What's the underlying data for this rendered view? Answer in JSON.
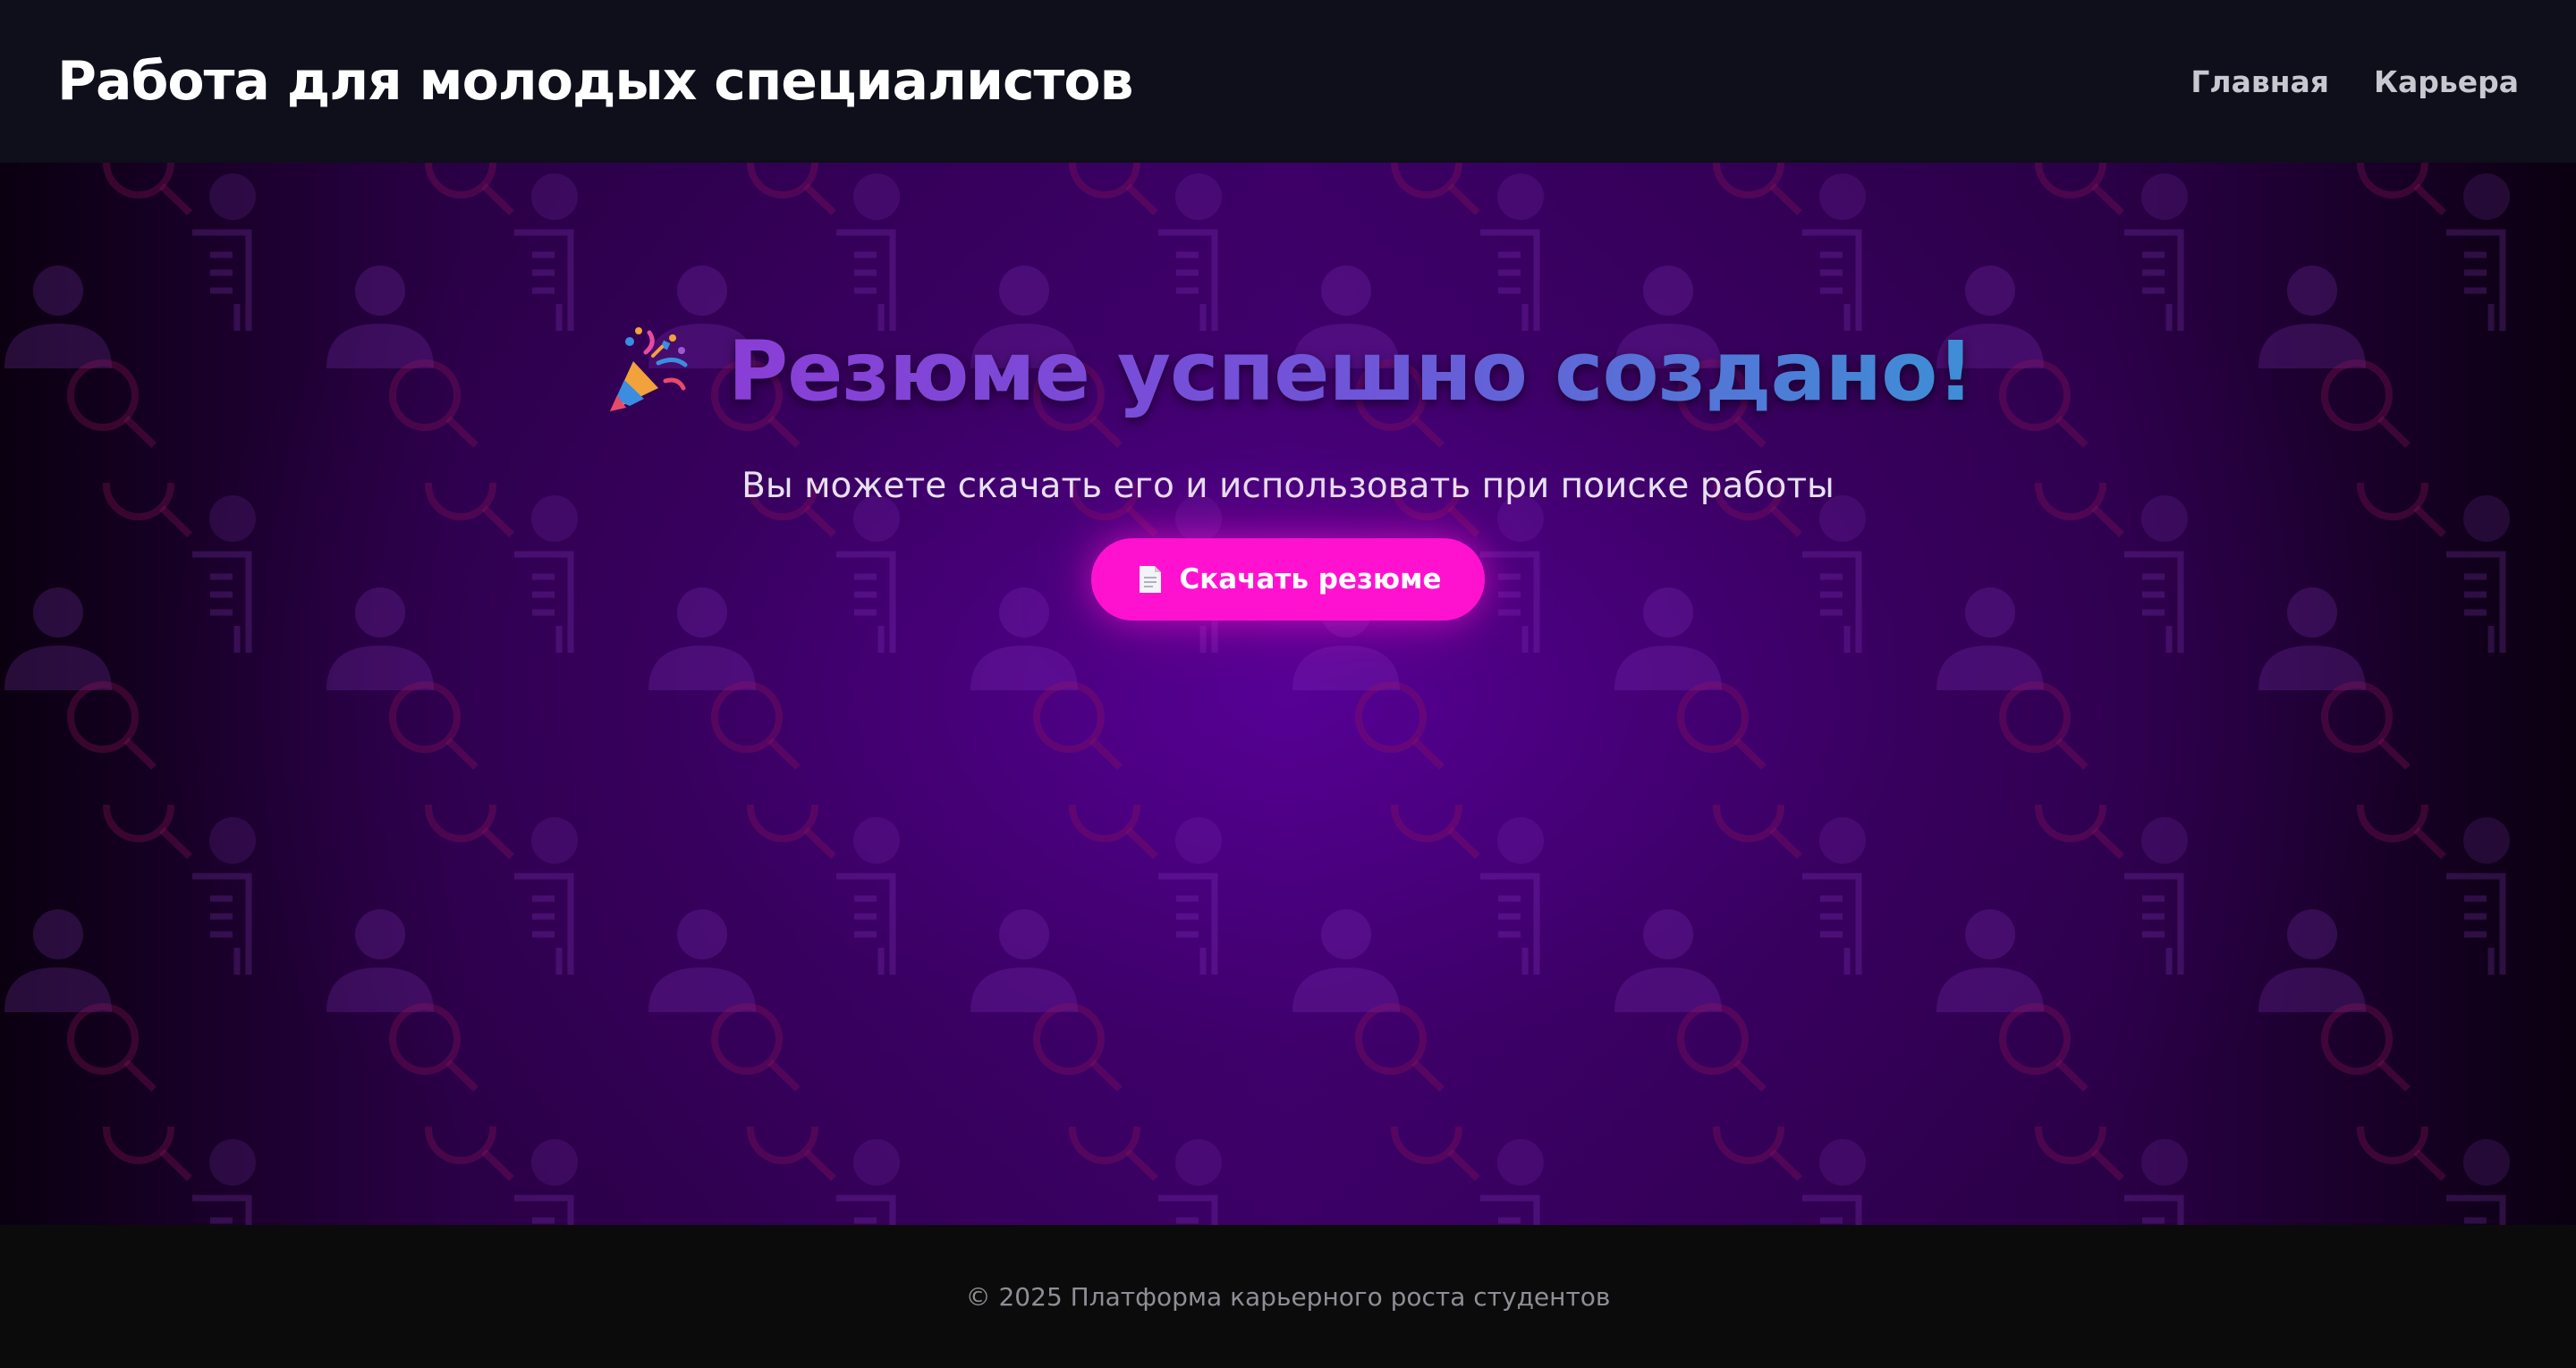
{
  "header": {
    "site_title": "Работа для молодых специалистов",
    "nav": [
      {
        "label": "Главная"
      },
      {
        "label": "Карьера"
      }
    ]
  },
  "hero": {
    "icon": "party-popper-icon",
    "title": "Резюме успешно создано!",
    "subtitle": "Вы можете скачать его и использовать при поиске работы",
    "download_button": {
      "icon": "document-icon",
      "label": "Скачать резюме"
    },
    "background_pattern_icons": [
      "resume-document-icon",
      "person-icon",
      "magnifier-icon"
    ]
  },
  "footer": {
    "copyright": "© 2025 Платформа карьерного роста студентов"
  },
  "colors": {
    "header_bg": "#0e0f1a",
    "hero_purple": "#3a0063",
    "title_gradient_start": "#8a3ed6",
    "title_gradient_end": "#3d8fd6",
    "button_bg": "#ff12cf",
    "footer_bg": "#0b0b0b"
  }
}
